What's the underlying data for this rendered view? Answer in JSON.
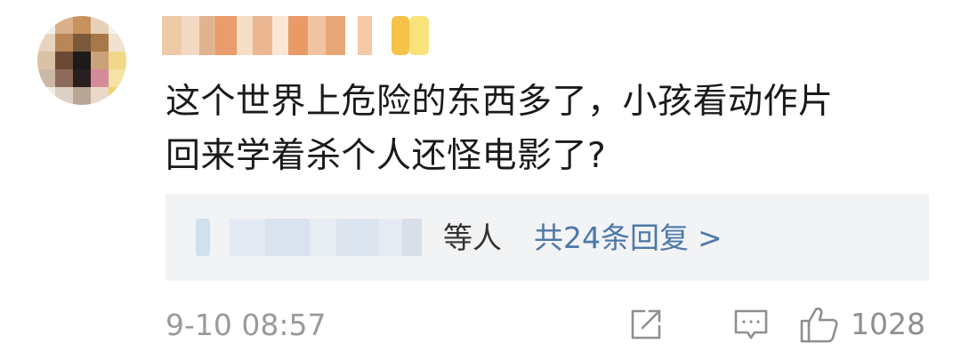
{
  "comment": {
    "text_line1": "这个世界上危险的东西多了，小孩看动作片",
    "text_line2": "回来学着杀个人还怪电影了?",
    "timestamp": "9-10 08:57"
  },
  "replies": {
    "suffix": "等人",
    "link_label": "共24条回复",
    "chevron": ">"
  },
  "actions": {
    "share_icon": "share-icon",
    "comment_icon": "comment-icon",
    "like_icon": "thumbs-up-icon",
    "like_count": "1028"
  },
  "colors": {
    "text": "#1a1a1a",
    "link": "#4d78a8",
    "muted": "#9a9a9a",
    "reply_bg": "#f2f3f5"
  }
}
